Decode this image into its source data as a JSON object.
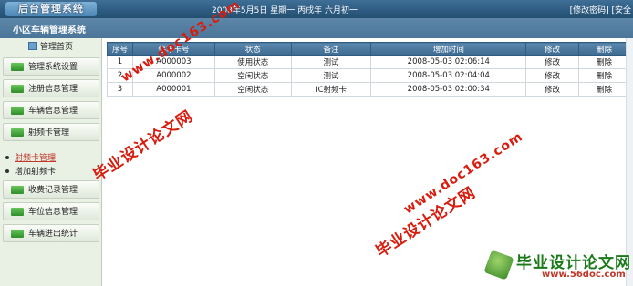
{
  "header": {
    "logo_text": "后台管理系统",
    "date_text": "2008年5月5日 星期一 丙戌年 六月初一",
    "links": {
      "change_password": "[修改密码]",
      "security": "[安全"
    }
  },
  "subheader": {
    "title": "小区车辆管理系统"
  },
  "sidebar": {
    "home_label": "管理首页",
    "menu": [
      {
        "label": "管理系统设置",
        "icon": "green-folder-icon"
      },
      {
        "label": "注册信息管理",
        "icon": "green-folder-icon"
      },
      {
        "label": "车辆信息管理",
        "icon": "green-folder-icon"
      },
      {
        "label": "射频卡管理",
        "icon": "green-folder-icon"
      }
    ],
    "sub_items": [
      {
        "label": "射频卡管理",
        "active": true
      },
      {
        "label": "增加射频卡",
        "active": false
      }
    ],
    "menu2": [
      {
        "label": "收费记录管理",
        "icon": "green-folder-icon"
      },
      {
        "label": "车位信息管理",
        "icon": "green-folder-icon"
      },
      {
        "label": "车辆进出统计",
        "icon": "green-folder-icon"
      }
    ]
  },
  "table": {
    "columns": [
      "序号",
      "停车卡号",
      "状态",
      "备注",
      "增加时间",
      "修改",
      "删除"
    ],
    "rows": [
      {
        "no": "1",
        "card": "A000003",
        "status": "使用状态",
        "note": "测试",
        "time": "2008-05-03 02:06:14",
        "edit": "修改",
        "del": "删除"
      },
      {
        "no": "2",
        "card": "A000002",
        "status": "空闲状态",
        "note": "测试",
        "time": "2008-05-03 02:04:04",
        "edit": "修改",
        "del": "删除"
      },
      {
        "no": "3",
        "card": "A000001",
        "status": "空闲状态",
        "note": "IC射频卡",
        "time": "2008-05-03 02:00:34",
        "edit": "修改",
        "del": "删除"
      }
    ]
  },
  "watermarks": {
    "cn_text": "毕业设计论文网",
    "url_text": "www.doc163.com",
    "brand_cn": "毕业设计论文网",
    "brand_url": "www.56doc.com"
  },
  "colors": {
    "header_blue": "#2d5a80",
    "watermark_red": "#d81c0e",
    "brand_green": "#1a7a1a"
  }
}
